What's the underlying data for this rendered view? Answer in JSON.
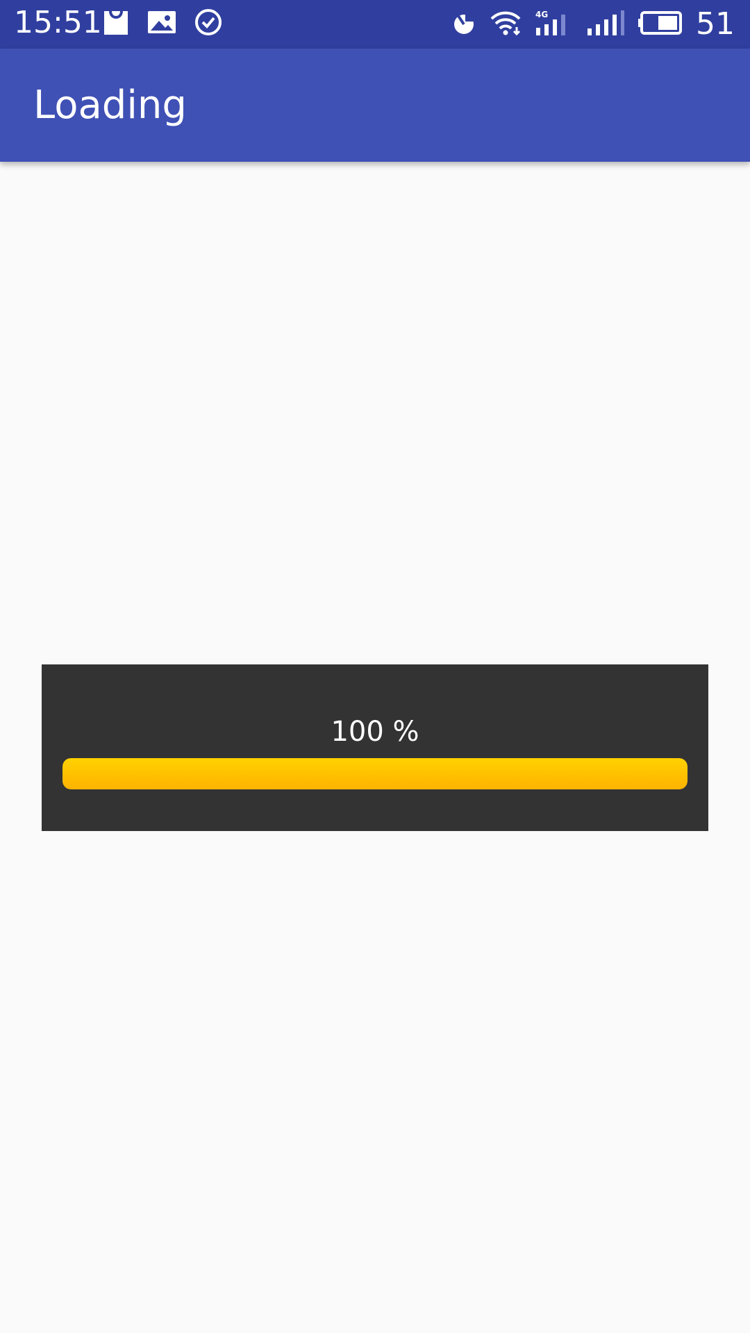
{
  "status_bar": {
    "time": "15:51",
    "left_icons": [
      "shopping-bag-icon",
      "image-icon",
      "check-circle-icon"
    ],
    "right_icons": [
      "data-saver-icon",
      "wifi-icon",
      "signal-4g-icon",
      "signal-icon",
      "battery-icon"
    ],
    "network_label": "4G",
    "battery_level": "51"
  },
  "app_bar": {
    "title": "Loading"
  },
  "dialog": {
    "percent_label": "100 %",
    "progress_fraction": 1.0
  },
  "colors": {
    "status_bar": "#303f9f",
    "app_bar": "#3f51b5",
    "background": "#fafafa",
    "dialog": "#333333",
    "progress": "#ffc200"
  }
}
